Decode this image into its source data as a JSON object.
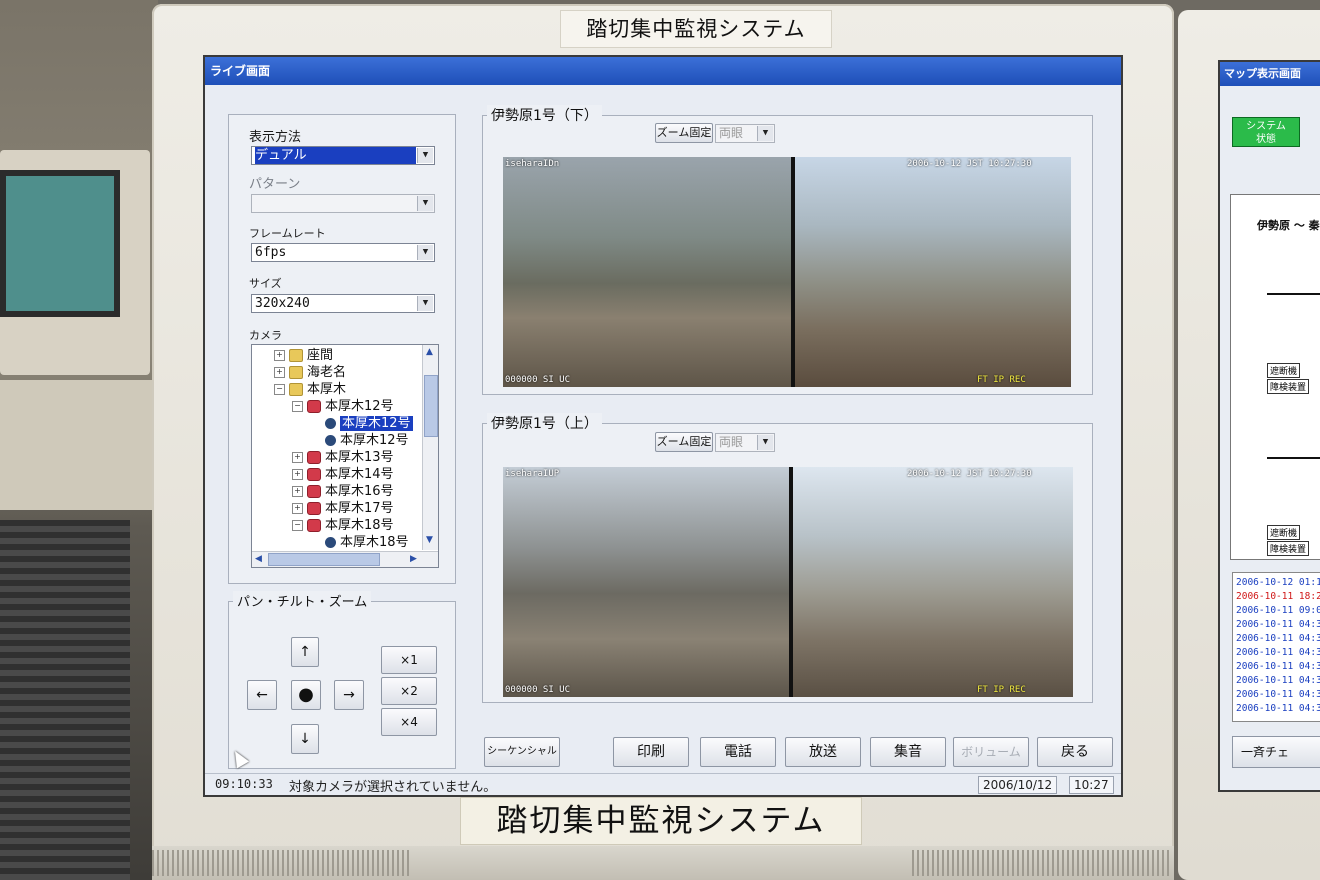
{
  "monitor": {
    "top_label": "踏切集中監視システム",
    "bottom_label": "踏切集中監視システム"
  },
  "window": {
    "title": "ライブ画面"
  },
  "left_panel": {
    "display_method_label": "表示方法",
    "display_method_value": "デュアル",
    "pattern_label": "パターン",
    "pattern_value": "",
    "frame_rate_label": "フレームレート",
    "frame_rate_value": "6fps",
    "size_label": "サイズ",
    "size_value": "320x240",
    "camera_label": "カメラ",
    "tree": [
      {
        "label": "座間",
        "kind": "folder",
        "level": 1,
        "expander": "+"
      },
      {
        "label": "海老名",
        "kind": "folder",
        "level": 1,
        "expander": "+"
      },
      {
        "label": "本厚木",
        "kind": "folder",
        "level": 1,
        "expander": "−"
      },
      {
        "label": "本厚木12号",
        "kind": "cam",
        "level": 2,
        "expander": "−"
      },
      {
        "label": "本厚木12号",
        "kind": "lens",
        "level": 3,
        "expander": "",
        "selected": true
      },
      {
        "label": "本厚木12号",
        "kind": "lens",
        "level": 3,
        "expander": ""
      },
      {
        "label": "本厚木13号",
        "kind": "cam",
        "level": 2,
        "expander": "+"
      },
      {
        "label": "本厚木14号",
        "kind": "cam",
        "level": 2,
        "expander": "+"
      },
      {
        "label": "本厚木16号",
        "kind": "cam",
        "level": 2,
        "expander": "+"
      },
      {
        "label": "本厚木17号",
        "kind": "cam",
        "level": 2,
        "expander": "+"
      },
      {
        "label": "本厚木18号",
        "kind": "cam",
        "level": 2,
        "expander": "−"
      },
      {
        "label": "本厚木18号",
        "kind": "lens",
        "level": 3,
        "expander": ""
      }
    ]
  },
  "ptz": {
    "title": "パン・チルト・ズーム",
    "up": "↑",
    "down": "↓",
    "left": "←",
    "right": "→",
    "center": "●",
    "zoom1": "×1",
    "zoom2": "×2",
    "zoom4": "×4"
  },
  "cameras": [
    {
      "title": "伊勢原1号（下）",
      "zoom_fixed_label": "ズーム固定",
      "zoom_select": "両眼",
      "osd_name": "iseharaIDn",
      "osd_time": "2006-10-12 JST 10:27:30",
      "osd_status": "000000 SI UC",
      "osd_rec": "FT IP REC"
    },
    {
      "title": "伊勢原1号（上）",
      "zoom_fixed_label": "ズーム固定",
      "zoom_select": "両眼",
      "osd_name": "iseharaIUP",
      "osd_time": "2006-10-12 JST 10:27:30",
      "osd_status": "000000 SI UC",
      "osd_rec": "FT IP REC"
    }
  ],
  "bottom_buttons": {
    "sequential": "シーケンシャル設定",
    "print": "印刷",
    "phone": "電話",
    "broadcast": "放送",
    "collect": "集音",
    "volume": "ボリューム",
    "back": "戻る"
  },
  "status": {
    "time": "09:10:33",
    "message": "対象カメラが選択されていません。",
    "date": "2006/10/12",
    "clock": "10:27"
  },
  "map_screen": {
    "title": "マップ表示画面",
    "system_status": "システム\n状態",
    "map_title": "伊勢原 ～ 秦",
    "tag_gate1": "遮断機",
    "tag_detector1": "障検装置",
    "tag_gate2": "遮断機",
    "tag_detector2": "障検装置",
    "log": [
      {
        "text": "2006-10-12 01:1",
        "color": "blue"
      },
      {
        "text": "2006-10-11 18:2",
        "color": "red"
      },
      {
        "text": "2006-10-11 09:0",
        "color": "blue"
      },
      {
        "text": "2006-10-11 04:3",
        "color": "blue"
      },
      {
        "text": "2006-10-11 04:3",
        "color": "blue"
      },
      {
        "text": "2006-10-11 04:3",
        "color": "blue"
      },
      {
        "text": "2006-10-11 04:3",
        "color": "blue"
      },
      {
        "text": "2006-10-11 04:3",
        "color": "blue"
      },
      {
        "text": "2006-10-11 04:3",
        "color": "blue"
      },
      {
        "text": "2006-10-11 04:3",
        "color": "blue"
      }
    ],
    "broadcast_button": "一斉チェ"
  },
  "colors": {
    "titlebar": "#1e4fb8",
    "selection": "#1a3fc0",
    "system_ok": "#2bbb4a",
    "log_alert": "#d01818"
  }
}
